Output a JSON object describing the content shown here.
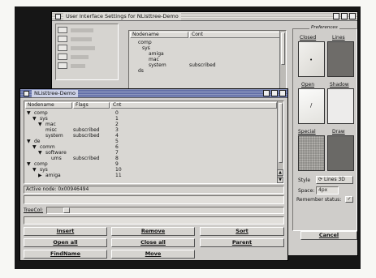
{
  "settings_window": {
    "title": "User Interface Settings for NListtree-Demo",
    "list": {
      "columns": [
        "Nodename",
        "Cont"
      ],
      "rows": [
        {
          "name": "comp",
          "cont": ""
        },
        {
          "name": "sys",
          "cont": ""
        },
        {
          "name": "amiga",
          "cont": ""
        },
        {
          "name": "mac",
          "cont": ""
        },
        {
          "name": "system",
          "cont": "subscribed"
        },
        {
          "name": "ds",
          "cont": ""
        }
      ]
    },
    "preferences": {
      "group_title": "Preferences",
      "closed_label": "Closed",
      "lines_label": "Lines",
      "open_label": "Open",
      "shadow_label": "Shadow",
      "special_label": "Special",
      "draw_label": "Draw",
      "style_label": "Style",
      "style_value": "Lines 3D",
      "space_label": "Space:",
      "space_value": "4px",
      "remember_label": "Remember status:",
      "cancel_label": "Cancel"
    }
  },
  "demo_window": {
    "title": "NListtree-Demo",
    "list": {
      "columns": [
        "Nodename",
        "Flags",
        "Cnt"
      ],
      "rows": [
        {
          "name": "comp",
          "flags": "",
          "cnt": "0"
        },
        {
          "name": "sys",
          "flags": "",
          "cnt": "1"
        },
        {
          "name": "mac",
          "flags": "",
          "cnt": "2"
        },
        {
          "name": "misc",
          "flags": "subscribed",
          "cnt": "3"
        },
        {
          "name": "system",
          "flags": "subscribed",
          "cnt": "4"
        },
        {
          "name": "de",
          "flags": "",
          "cnt": "5"
        },
        {
          "name": "comm",
          "flags": "",
          "cnt": "6"
        },
        {
          "name": "software",
          "flags": "",
          "cnt": "7"
        },
        {
          "name": "ums",
          "flags": "subscribed",
          "cnt": "8"
        },
        {
          "name": "comp",
          "flags": "",
          "cnt": "9"
        },
        {
          "name": "sys",
          "flags": "",
          "cnt": "10"
        },
        {
          "name": "amiga",
          "flags": "",
          "cnt": "11"
        }
      ]
    },
    "active_node": "Active node: 0x00946494",
    "treecol_label": "TreeCol:",
    "treecol_level": 0.07,
    "buttons": {
      "insert": "Insert",
      "remove": "Remove",
      "sort": "Sort",
      "open_all": "Open all",
      "close_all": "Close all",
      "parent": "Parent",
      "find_name": "FindName",
      "move": "Move"
    }
  }
}
